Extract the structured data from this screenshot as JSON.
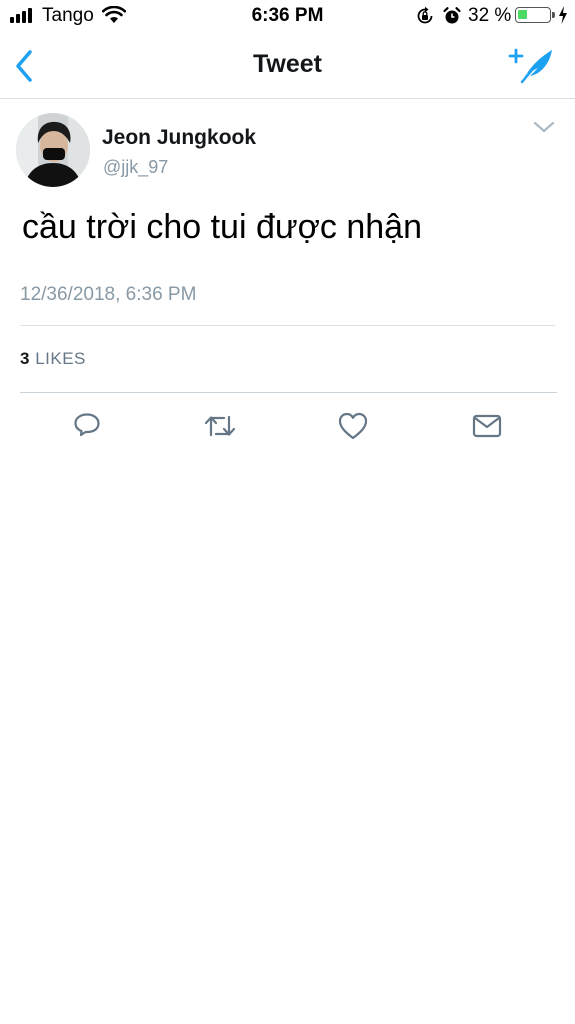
{
  "status_bar": {
    "carrier": "Tango",
    "time": "6:36 PM",
    "battery_percent": "32 %",
    "battery_level": 0.32,
    "icons": [
      "signal-bars-icon",
      "wifi-icon",
      "rotation-lock-icon",
      "alarm-icon",
      "battery-icon",
      "charging-bolt-icon"
    ]
  },
  "nav": {
    "title": "Tweet",
    "back_icon": "chevron-left-icon",
    "compose_icon": "compose-tweet-icon"
  },
  "tweet": {
    "author_name": "Jeon Jungkook",
    "author_handle": "@jjk_97",
    "text": "cầu trời cho tui được nhận",
    "timestamp": "12/36/2018, 6:36 PM",
    "likes_count": "3",
    "likes_label": "LIKES"
  },
  "actions": [
    {
      "icon": "reply-icon"
    },
    {
      "icon": "retweet-icon"
    },
    {
      "icon": "like-heart-icon"
    },
    {
      "icon": "share-mail-icon"
    }
  ],
  "colors": {
    "accent": "#1da1f2",
    "secondary_text": "#8899a6",
    "primary_text": "#14171a",
    "battery_fill": "#4cd964"
  }
}
